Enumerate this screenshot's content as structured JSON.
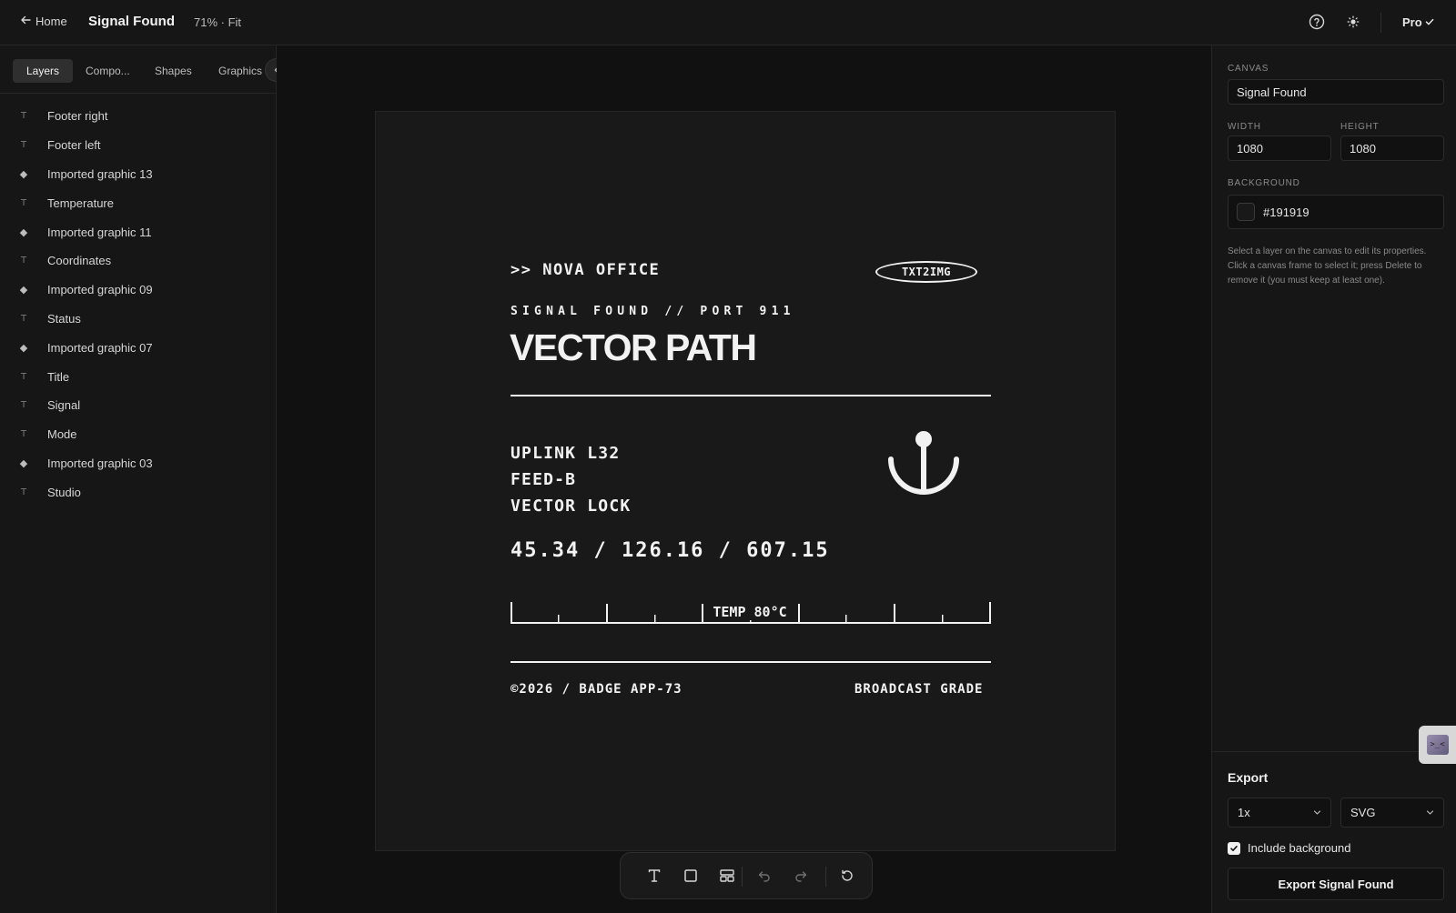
{
  "topbar": {
    "home_label": "Home",
    "doc_title": "Signal Found",
    "zoom": "71% · Fit",
    "plan": "Pro"
  },
  "sidebar": {
    "tabs": [
      {
        "label": "Layers",
        "active": true
      },
      {
        "label": "Compo...",
        "active": false
      },
      {
        "label": "Shapes",
        "active": false
      },
      {
        "label": "Graphics",
        "active": false
      }
    ],
    "layers": [
      {
        "label": "Footer right",
        "type": "text"
      },
      {
        "label": "Footer left",
        "type": "text"
      },
      {
        "label": "Imported graphic 13",
        "type": "graphic"
      },
      {
        "label": "Temperature",
        "type": "text"
      },
      {
        "label": "Imported graphic 11",
        "type": "graphic"
      },
      {
        "label": "Coordinates",
        "type": "text"
      },
      {
        "label": "Imported graphic 09",
        "type": "graphic"
      },
      {
        "label": "Status",
        "type": "text"
      },
      {
        "label": "Imported graphic 07",
        "type": "graphic"
      },
      {
        "label": "Title",
        "type": "text"
      },
      {
        "label": "Signal",
        "type": "text"
      },
      {
        "label": "Mode",
        "type": "text"
      },
      {
        "label": "Imported graphic 03",
        "type": "graphic"
      },
      {
        "label": "Studio",
        "type": "text"
      }
    ],
    "layer_icons": {
      "text": "T",
      "graphic": "◆"
    }
  },
  "artboard": {
    "background": "#191919",
    "foreground": "#f2f2f2",
    "studio": ">> NOVA OFFICE",
    "mode": "TXT2IMG",
    "signal": "SIGNAL FOUND // PORT 911",
    "title": "VECTOR PATH",
    "status": [
      "UPLINK L32",
      "FEED-B",
      "VECTOR LOCK"
    ],
    "coordinates": "45.34 / 126.16 / 607.15",
    "temperature": "TEMP 80°C",
    "footer_left": "©2026 / BADGE APP-73",
    "footer_right": "BROADCAST GRADE",
    "icon": "anchor-icon"
  },
  "toolbar": {
    "tools": [
      "text-tool-icon",
      "rectangle-tool-icon",
      "layout-tool-icon",
      "undo-icon",
      "redo-icon",
      "reset-icon"
    ]
  },
  "panel": {
    "canvas_label": "CANVAS",
    "canvas_name": "Signal Found",
    "width_label": "WIDTH",
    "width": "1080",
    "height_label": "HEIGHT",
    "height": "1080",
    "background_label": "BACKGROUND",
    "background": "#191919",
    "hint": "Select a layer on the canvas to edit its properties. Click a canvas frame to select it; press Delete to remove it (you must keep at least one).",
    "export_title": "Export",
    "scale": "1x",
    "format": "SVG",
    "include_background_label": "Include background",
    "include_background": true,
    "export_button": "Export Signal Found"
  },
  "colors": {
    "app_bg": "#111111",
    "panel_bg": "#161616",
    "border": "#262626",
    "text": "#e6e6e6",
    "muted": "#8a8a8a"
  }
}
